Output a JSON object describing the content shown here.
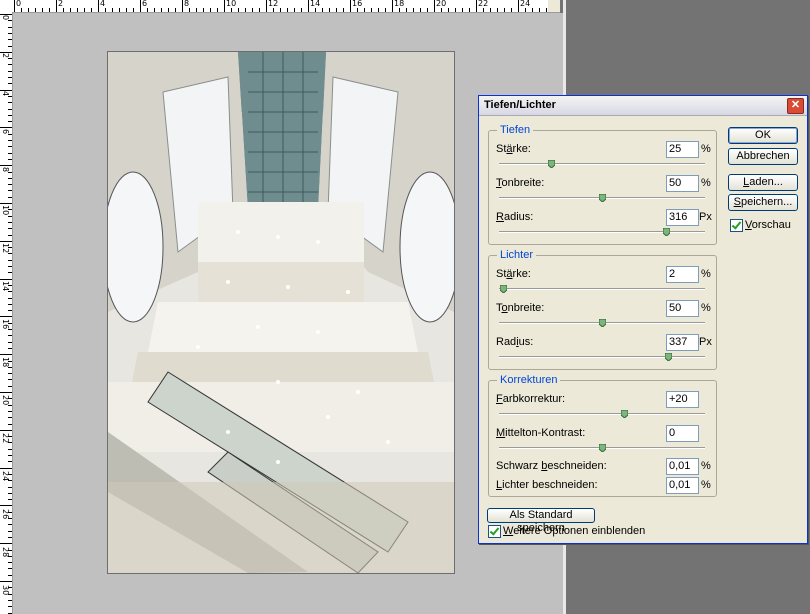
{
  "ruler": {
    "top_labels": [
      "0",
      "2",
      "4",
      "6",
      "8",
      "10",
      "12",
      "14",
      "16",
      "18",
      "20",
      "22",
      "24"
    ],
    "left_labels": [
      "0",
      "2",
      "4",
      "6",
      "8",
      "10",
      "12",
      "14",
      "16",
      "18",
      "20",
      "22",
      "24",
      "26",
      "28",
      "30"
    ]
  },
  "dialog": {
    "title": "Tiefen/Lichter",
    "close_icon": "close-icon",
    "tiefen": {
      "title": "Tiefen",
      "staerke": {
        "label_pre": "St",
        "label_u": "ä",
        "label_post": "rke:",
        "value": "25",
        "unit": "%",
        "level_percent": 25
      },
      "tonbreite": {
        "label_pre": "",
        "label_u": "T",
        "label_post": "onbreite:",
        "value": "50",
        "unit": "%",
        "level_percent": 50
      },
      "radius": {
        "label_pre": "",
        "label_u": "R",
        "label_post": "adius:",
        "value": "316",
        "unit": "Px"
      }
    },
    "lichter": {
      "title": "Lichter",
      "staerke": {
        "label_pre": "St",
        "label_u": "ä",
        "label_post": "rke:",
        "value": "2",
        "unit": "%",
        "level_percent": 2
      },
      "tonbreite": {
        "label_pre": "T",
        "label_u": "o",
        "label_post": "nbreite:",
        "value": "50",
        "unit": "%",
        "level_percent": 50
      },
      "radius": {
        "label_pre": "Rad",
        "label_u": "i",
        "label_post": "us:",
        "value": "337",
        "unit": "Px"
      }
    },
    "korrekturen": {
      "title": "Korrekturen",
      "farbkorrektur": {
        "label_pre": "",
        "label_u": "F",
        "label_post": "arbkorrektur:",
        "value": "+20"
      },
      "mittelton": {
        "label_pre": "",
        "label_u": "M",
        "label_post": "ittelton-Kontrast:",
        "value": "0"
      },
      "schwarz": {
        "label_pre": "Schwarz ",
        "label_u": "b",
        "label_post": "eschneiden:",
        "value": "0,01",
        "unit": "%"
      },
      "lichter": {
        "label_pre": "",
        "label_u": "L",
        "label_post": "ichter beschneiden:",
        "value": "0,01",
        "unit": "%"
      }
    },
    "buttons": {
      "ok": "OK",
      "abbrechen": "Abbrechen",
      "laden_pre": "",
      "laden_u": "L",
      "laden_post": "aden...",
      "speichern_pre": "",
      "speichern_u": "S",
      "speichern_post": "peichern...",
      "standard": "Als Standard speichern"
    },
    "vorschau": {
      "label_pre": "",
      "label_u": "V",
      "label_post": "orschau",
      "checked": true
    },
    "weitere": {
      "label_pre": "",
      "label_u": "W",
      "label_post": "eitere Optionen einblenden",
      "checked": true
    }
  }
}
